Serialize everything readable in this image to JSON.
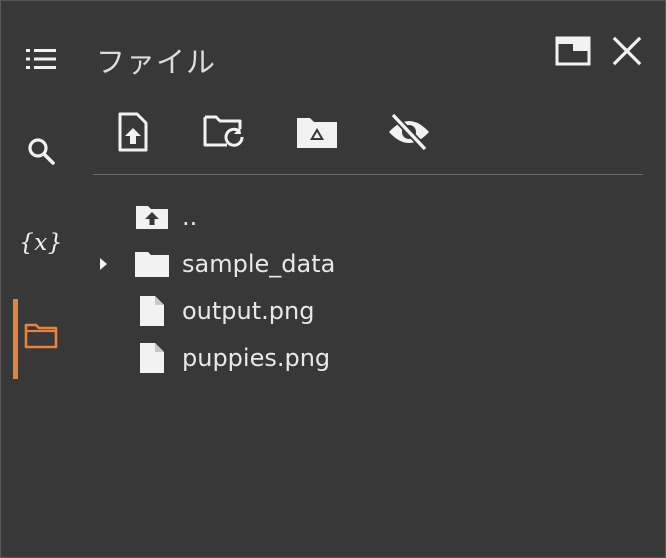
{
  "theme": {
    "accent": "#e8823a",
    "icon_color": "#f2f2f2",
    "background": "#383838"
  },
  "sidebar": {
    "items": [
      {
        "name": "table-of-contents",
        "icon": "list-icon",
        "active": false
      },
      {
        "name": "search",
        "icon": "search-icon",
        "active": false
      },
      {
        "name": "variables",
        "icon": "variables-icon",
        "label": "{x}",
        "active": false
      },
      {
        "name": "files",
        "icon": "folder-icon",
        "active": true
      }
    ]
  },
  "header": {
    "title": "ファイル",
    "actions": [
      {
        "name": "open-in-tab",
        "icon": "window-icon"
      },
      {
        "name": "close",
        "icon": "close-icon"
      }
    ]
  },
  "toolbar": {
    "buttons": [
      {
        "name": "upload",
        "icon": "upload-file-icon"
      },
      {
        "name": "refresh",
        "icon": "refresh-folder-icon"
      },
      {
        "name": "mount-drive",
        "icon": "drive-folder-icon"
      },
      {
        "name": "toggle-hidden",
        "icon": "eye-off-icon"
      }
    ]
  },
  "files": {
    "items": [
      {
        "label": "..",
        "type": "parent",
        "icon": "folder-up-icon",
        "expandable": false
      },
      {
        "label": "sample_data",
        "type": "folder",
        "icon": "folder-icon",
        "expandable": true
      },
      {
        "label": "output.png",
        "type": "file",
        "icon": "file-icon",
        "expandable": false
      },
      {
        "label": "puppies.png",
        "type": "file",
        "icon": "file-icon",
        "expandable": false
      }
    ]
  }
}
